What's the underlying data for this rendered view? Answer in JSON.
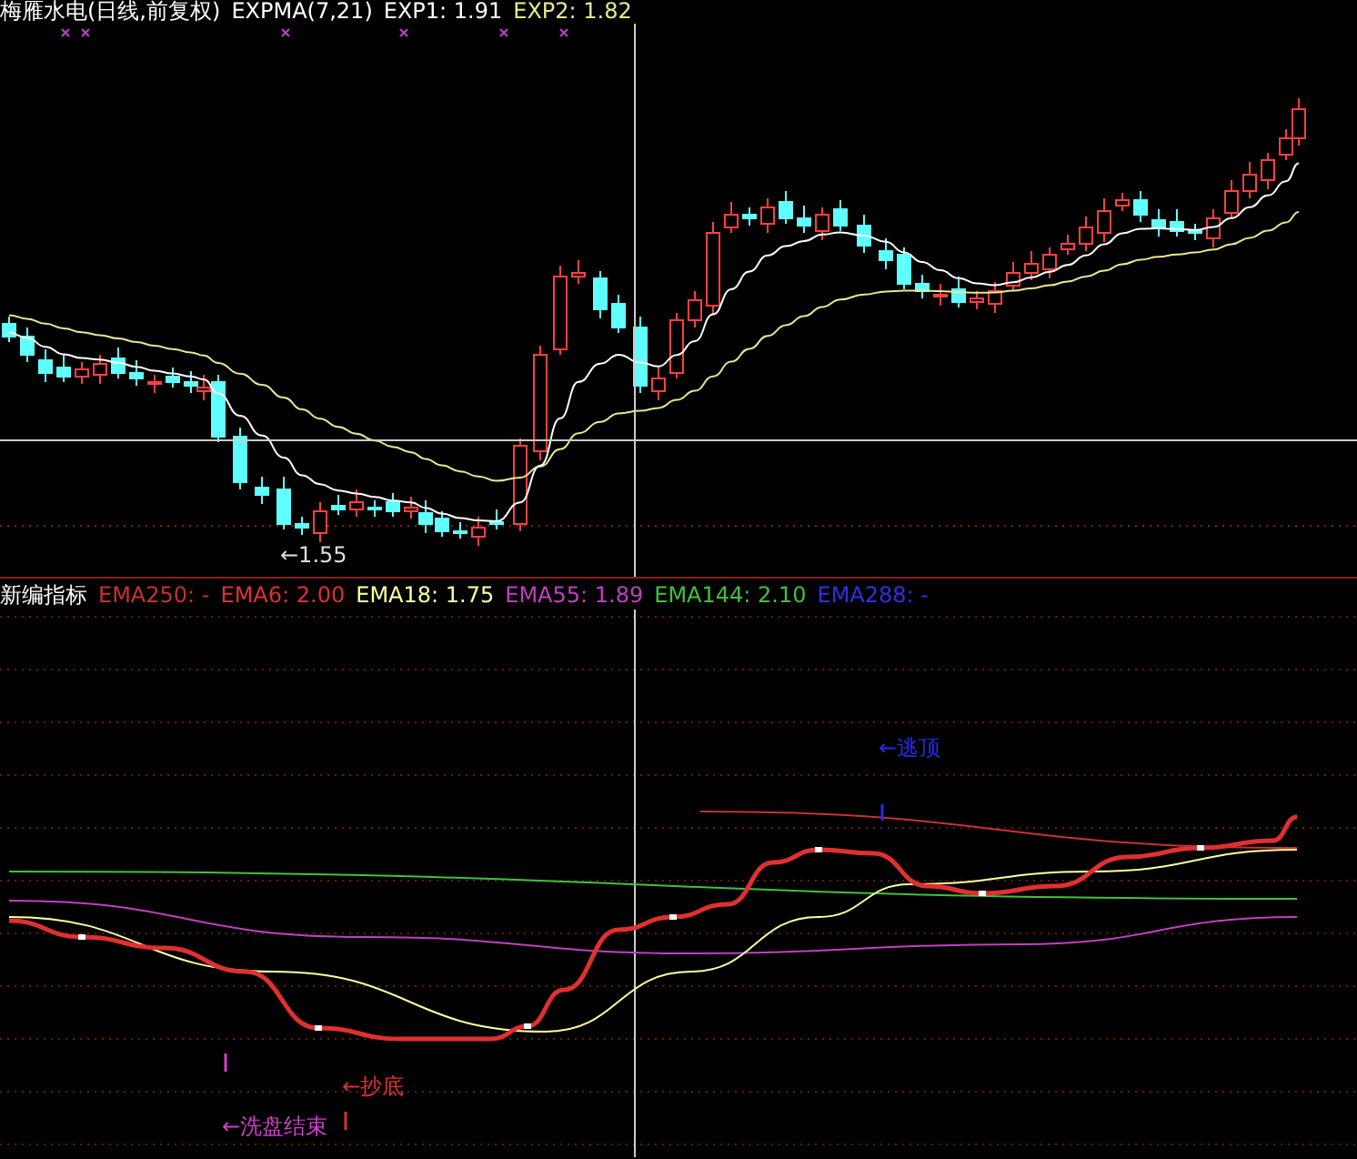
{
  "main_panel": {
    "title": "梅雁水电(日线,前复权)",
    "indicator": "EXPMA(7,21)",
    "readings": [
      {
        "label": "EXP1: 1.91",
        "color": "#ffffff"
      },
      {
        "label": "EXP2: 1.82",
        "color": "#e8e890"
      }
    ],
    "low_label": "←1.55"
  },
  "indicator_panel": {
    "title": "新编指标",
    "readings": [
      {
        "label": "EMA250: -",
        "color": "#c83232"
      },
      {
        "label": "EMA6: 2.00",
        "color": "#e03030"
      },
      {
        "label": "EMA18: 1.75",
        "color": "#ffffa0"
      },
      {
        "label": "EMA55: 1.89",
        "color": "#c040c0"
      },
      {
        "label": "EMA144: 2.10",
        "color": "#40c040"
      },
      {
        "label": "EMA288: -",
        "color": "#3030e0"
      }
    ],
    "annotations": [
      {
        "text": "←逃顶",
        "color": "#2828f0"
      },
      {
        "text": "←抄底",
        "color": "#e03030"
      },
      {
        "text": "←洗盘结束",
        "color": "#d040d0"
      }
    ]
  }
}
